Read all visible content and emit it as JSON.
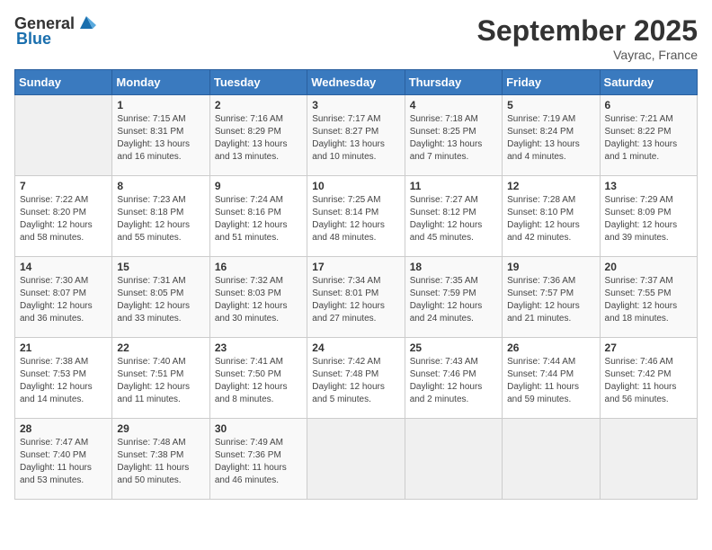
{
  "header": {
    "logo_general": "General",
    "logo_blue": "Blue",
    "month_year": "September 2025",
    "location": "Vayrac, France"
  },
  "weekdays": [
    "Sunday",
    "Monday",
    "Tuesday",
    "Wednesday",
    "Thursday",
    "Friday",
    "Saturday"
  ],
  "weeks": [
    [
      {
        "day": "",
        "sunrise": "",
        "sunset": "",
        "daylight": ""
      },
      {
        "day": "1",
        "sunrise": "Sunrise: 7:15 AM",
        "sunset": "Sunset: 8:31 PM",
        "daylight": "Daylight: 13 hours and 16 minutes."
      },
      {
        "day": "2",
        "sunrise": "Sunrise: 7:16 AM",
        "sunset": "Sunset: 8:29 PM",
        "daylight": "Daylight: 13 hours and 13 minutes."
      },
      {
        "day": "3",
        "sunrise": "Sunrise: 7:17 AM",
        "sunset": "Sunset: 8:27 PM",
        "daylight": "Daylight: 13 hours and 10 minutes."
      },
      {
        "day": "4",
        "sunrise": "Sunrise: 7:18 AM",
        "sunset": "Sunset: 8:25 PM",
        "daylight": "Daylight: 13 hours and 7 minutes."
      },
      {
        "day": "5",
        "sunrise": "Sunrise: 7:19 AM",
        "sunset": "Sunset: 8:24 PM",
        "daylight": "Daylight: 13 hours and 4 minutes."
      },
      {
        "day": "6",
        "sunrise": "Sunrise: 7:21 AM",
        "sunset": "Sunset: 8:22 PM",
        "daylight": "Daylight: 13 hours and 1 minute."
      }
    ],
    [
      {
        "day": "7",
        "sunrise": "Sunrise: 7:22 AM",
        "sunset": "Sunset: 8:20 PM",
        "daylight": "Daylight: 12 hours and 58 minutes."
      },
      {
        "day": "8",
        "sunrise": "Sunrise: 7:23 AM",
        "sunset": "Sunset: 8:18 PM",
        "daylight": "Daylight: 12 hours and 55 minutes."
      },
      {
        "day": "9",
        "sunrise": "Sunrise: 7:24 AM",
        "sunset": "Sunset: 8:16 PM",
        "daylight": "Daylight: 12 hours and 51 minutes."
      },
      {
        "day": "10",
        "sunrise": "Sunrise: 7:25 AM",
        "sunset": "Sunset: 8:14 PM",
        "daylight": "Daylight: 12 hours and 48 minutes."
      },
      {
        "day": "11",
        "sunrise": "Sunrise: 7:27 AM",
        "sunset": "Sunset: 8:12 PM",
        "daylight": "Daylight: 12 hours and 45 minutes."
      },
      {
        "day": "12",
        "sunrise": "Sunrise: 7:28 AM",
        "sunset": "Sunset: 8:10 PM",
        "daylight": "Daylight: 12 hours and 42 minutes."
      },
      {
        "day": "13",
        "sunrise": "Sunrise: 7:29 AM",
        "sunset": "Sunset: 8:09 PM",
        "daylight": "Daylight: 12 hours and 39 minutes."
      }
    ],
    [
      {
        "day": "14",
        "sunrise": "Sunrise: 7:30 AM",
        "sunset": "Sunset: 8:07 PM",
        "daylight": "Daylight: 12 hours and 36 minutes."
      },
      {
        "day": "15",
        "sunrise": "Sunrise: 7:31 AM",
        "sunset": "Sunset: 8:05 PM",
        "daylight": "Daylight: 12 hours and 33 minutes."
      },
      {
        "day": "16",
        "sunrise": "Sunrise: 7:32 AM",
        "sunset": "Sunset: 8:03 PM",
        "daylight": "Daylight: 12 hours and 30 minutes."
      },
      {
        "day": "17",
        "sunrise": "Sunrise: 7:34 AM",
        "sunset": "Sunset: 8:01 PM",
        "daylight": "Daylight: 12 hours and 27 minutes."
      },
      {
        "day": "18",
        "sunrise": "Sunrise: 7:35 AM",
        "sunset": "Sunset: 7:59 PM",
        "daylight": "Daylight: 12 hours and 24 minutes."
      },
      {
        "day": "19",
        "sunrise": "Sunrise: 7:36 AM",
        "sunset": "Sunset: 7:57 PM",
        "daylight": "Daylight: 12 hours and 21 minutes."
      },
      {
        "day": "20",
        "sunrise": "Sunrise: 7:37 AM",
        "sunset": "Sunset: 7:55 PM",
        "daylight": "Daylight: 12 hours and 18 minutes."
      }
    ],
    [
      {
        "day": "21",
        "sunrise": "Sunrise: 7:38 AM",
        "sunset": "Sunset: 7:53 PM",
        "daylight": "Daylight: 12 hours and 14 minutes."
      },
      {
        "day": "22",
        "sunrise": "Sunrise: 7:40 AM",
        "sunset": "Sunset: 7:51 PM",
        "daylight": "Daylight: 12 hours and 11 minutes."
      },
      {
        "day": "23",
        "sunrise": "Sunrise: 7:41 AM",
        "sunset": "Sunset: 7:50 PM",
        "daylight": "Daylight: 12 hours and 8 minutes."
      },
      {
        "day": "24",
        "sunrise": "Sunrise: 7:42 AM",
        "sunset": "Sunset: 7:48 PM",
        "daylight": "Daylight: 12 hours and 5 minutes."
      },
      {
        "day": "25",
        "sunrise": "Sunrise: 7:43 AM",
        "sunset": "Sunset: 7:46 PM",
        "daylight": "Daylight: 12 hours and 2 minutes."
      },
      {
        "day": "26",
        "sunrise": "Sunrise: 7:44 AM",
        "sunset": "Sunset: 7:44 PM",
        "daylight": "Daylight: 11 hours and 59 minutes."
      },
      {
        "day": "27",
        "sunrise": "Sunrise: 7:46 AM",
        "sunset": "Sunset: 7:42 PM",
        "daylight": "Daylight: 11 hours and 56 minutes."
      }
    ],
    [
      {
        "day": "28",
        "sunrise": "Sunrise: 7:47 AM",
        "sunset": "Sunset: 7:40 PM",
        "daylight": "Daylight: 11 hours and 53 minutes."
      },
      {
        "day": "29",
        "sunrise": "Sunrise: 7:48 AM",
        "sunset": "Sunset: 7:38 PM",
        "daylight": "Daylight: 11 hours and 50 minutes."
      },
      {
        "day": "30",
        "sunrise": "Sunrise: 7:49 AM",
        "sunset": "Sunset: 7:36 PM",
        "daylight": "Daylight: 11 hours and 46 minutes."
      },
      {
        "day": "",
        "sunrise": "",
        "sunset": "",
        "daylight": ""
      },
      {
        "day": "",
        "sunrise": "",
        "sunset": "",
        "daylight": ""
      },
      {
        "day": "",
        "sunrise": "",
        "sunset": "",
        "daylight": ""
      },
      {
        "day": "",
        "sunrise": "",
        "sunset": "",
        "daylight": ""
      }
    ]
  ]
}
